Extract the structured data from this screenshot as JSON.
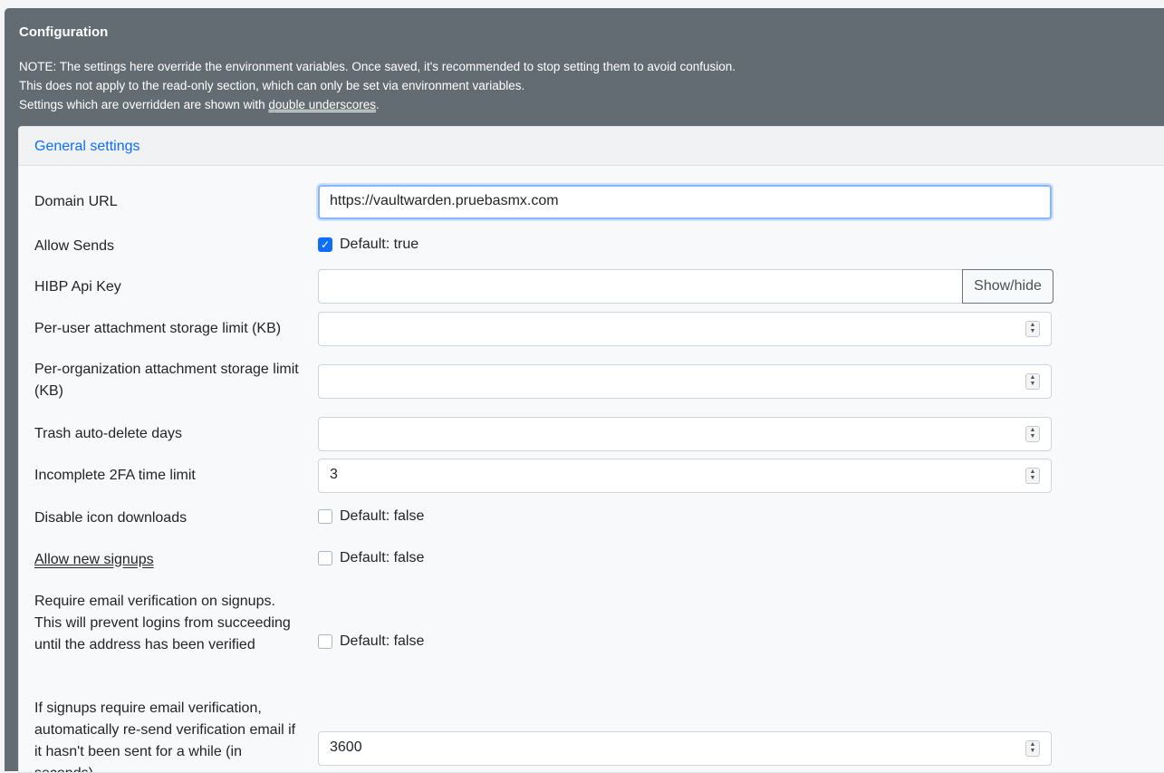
{
  "panel": {
    "title": "Configuration",
    "note_lines": [
      "NOTE: The settings here override the environment variables. Once saved, it's recommended to stop setting them to avoid confusion.",
      "This does not apply to the read-only section, which can only be set via environment variables."
    ],
    "note_line3_prefix": "Settings which are overridden are shown with ",
    "note_line3_link": "double underscores",
    "note_line3_suffix": "."
  },
  "section": {
    "title": "General settings"
  },
  "fields": {
    "domain_url": {
      "label": "Domain URL",
      "value": "https://vaultwarden.pruebasmx.com"
    },
    "allow_sends": {
      "label": "Allow Sends",
      "checked": true,
      "default": "Default: true"
    },
    "hibp_api_key": {
      "label": "HIBP Api Key",
      "value": "",
      "button": "Show/hide"
    },
    "user_attachment_limit": {
      "label": "Per-user attachment storage limit (KB)",
      "value": ""
    },
    "org_attachment_limit": {
      "label": "Per-organization attachment storage limit (KB)",
      "value": ""
    },
    "trash_auto_delete": {
      "label": "Trash auto-delete days",
      "value": ""
    },
    "incomplete_2fa": {
      "label": "Incomplete 2FA time limit",
      "value": "3"
    },
    "disable_icon_downloads": {
      "label": "Disable icon downloads",
      "checked": false,
      "default": "Default: false"
    },
    "allow_new_signups": {
      "label": "Allow new signups",
      "checked": false,
      "default": "Default: false"
    },
    "require_email_verification": {
      "label": "Require email verification on signups. This will prevent logins from succeeding until the address has been verified",
      "checked": false,
      "default": "Default: false"
    },
    "resend_verification": {
      "label": "If signups require email verification, automatically re-send verification email if it hasn't been sent for a while (in seconds)",
      "value": "3600"
    }
  },
  "colors": {
    "panel_bg": "#636b73",
    "link": "#0d6efd",
    "checkbox_on": "#0d6efd"
  }
}
